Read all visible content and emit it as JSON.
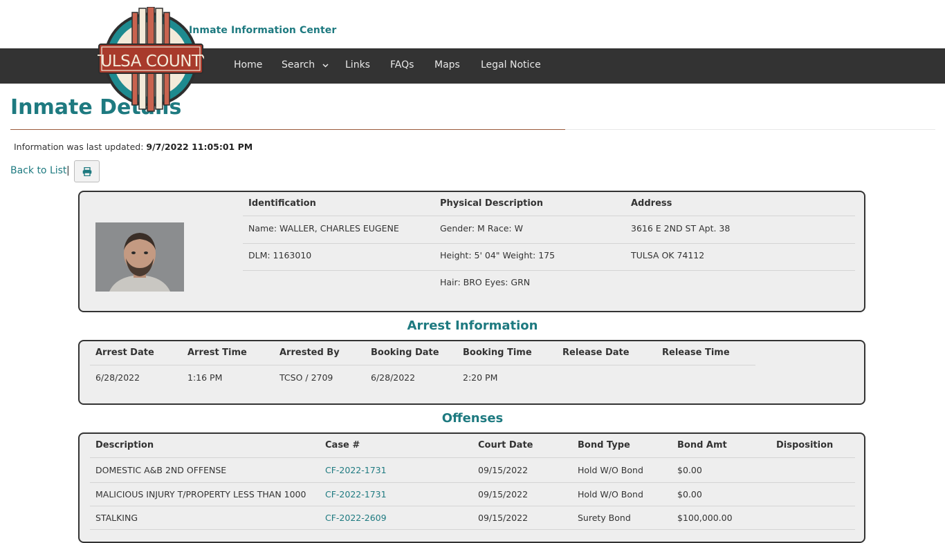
{
  "site": {
    "title": "Inmate Information Center",
    "logo_text": "TULSA COUNTY"
  },
  "nav": {
    "items": [
      "Home",
      "Search",
      "Links",
      "FAQs",
      "Maps",
      "Legal Notice"
    ]
  },
  "page": {
    "title": "Inmate Details",
    "updated_prefix": "Information was last updated:",
    "updated_value": "9/7/2022 11:05:01 PM",
    "back_link": "Back to List",
    "separator": "|"
  },
  "inmate": {
    "headers": {
      "identification": "Identification",
      "physical": "Physical Description",
      "address": "Address"
    },
    "name": "Name: WALLER, CHARLES EUGENE",
    "dlm": "DLM: 1163010",
    "gender_race": "Gender: M Race: W",
    "height_weight": "Height: 5' 04\" Weight: 175",
    "hair_eyes": "Hair: BRO Eyes: GRN",
    "address_line1": "3616 E 2ND ST Apt. 38",
    "address_line2": "TULSA OK 74112"
  },
  "arrest": {
    "title": "Arrest Information",
    "headers": [
      "Arrest Date",
      "Arrest Time",
      "Arrested By",
      "Booking Date",
      "Booking Time",
      "Release Date",
      "Release Time"
    ],
    "row": [
      "6/28/2022",
      "1:16 PM",
      "TCSO / 2709",
      "6/28/2022",
      "2:20 PM",
      "",
      ""
    ]
  },
  "offenses": {
    "title": "Offenses",
    "headers": [
      "Description",
      "Case #",
      "Court Date",
      "Bond Type",
      "Bond Amt",
      "Disposition"
    ],
    "rows": [
      [
        "DOMESTIC A&B 2ND OFFENSE",
        "CF-2022-1731",
        "09/15/2022",
        "Hold W/O Bond",
        "$0.00",
        ""
      ],
      [
        "MALICIOUS INJURY T/PROPERTY LESS THAN 1000",
        "CF-2022-1731",
        "09/15/2022",
        "Hold W/O Bond",
        "$0.00",
        ""
      ],
      [
        "STALKING",
        "CF-2022-2609",
        "09/15/2022",
        "Surety Bond",
        "$100,000.00",
        ""
      ]
    ]
  },
  "colors": {
    "accent": "#1e7a80",
    "nav_bg": "#333333",
    "panel_bg": "#eeeeee",
    "rule": "#9a5a3c"
  },
  "icons": {
    "print": "print-icon",
    "caret": "chevron-down-icon"
  }
}
